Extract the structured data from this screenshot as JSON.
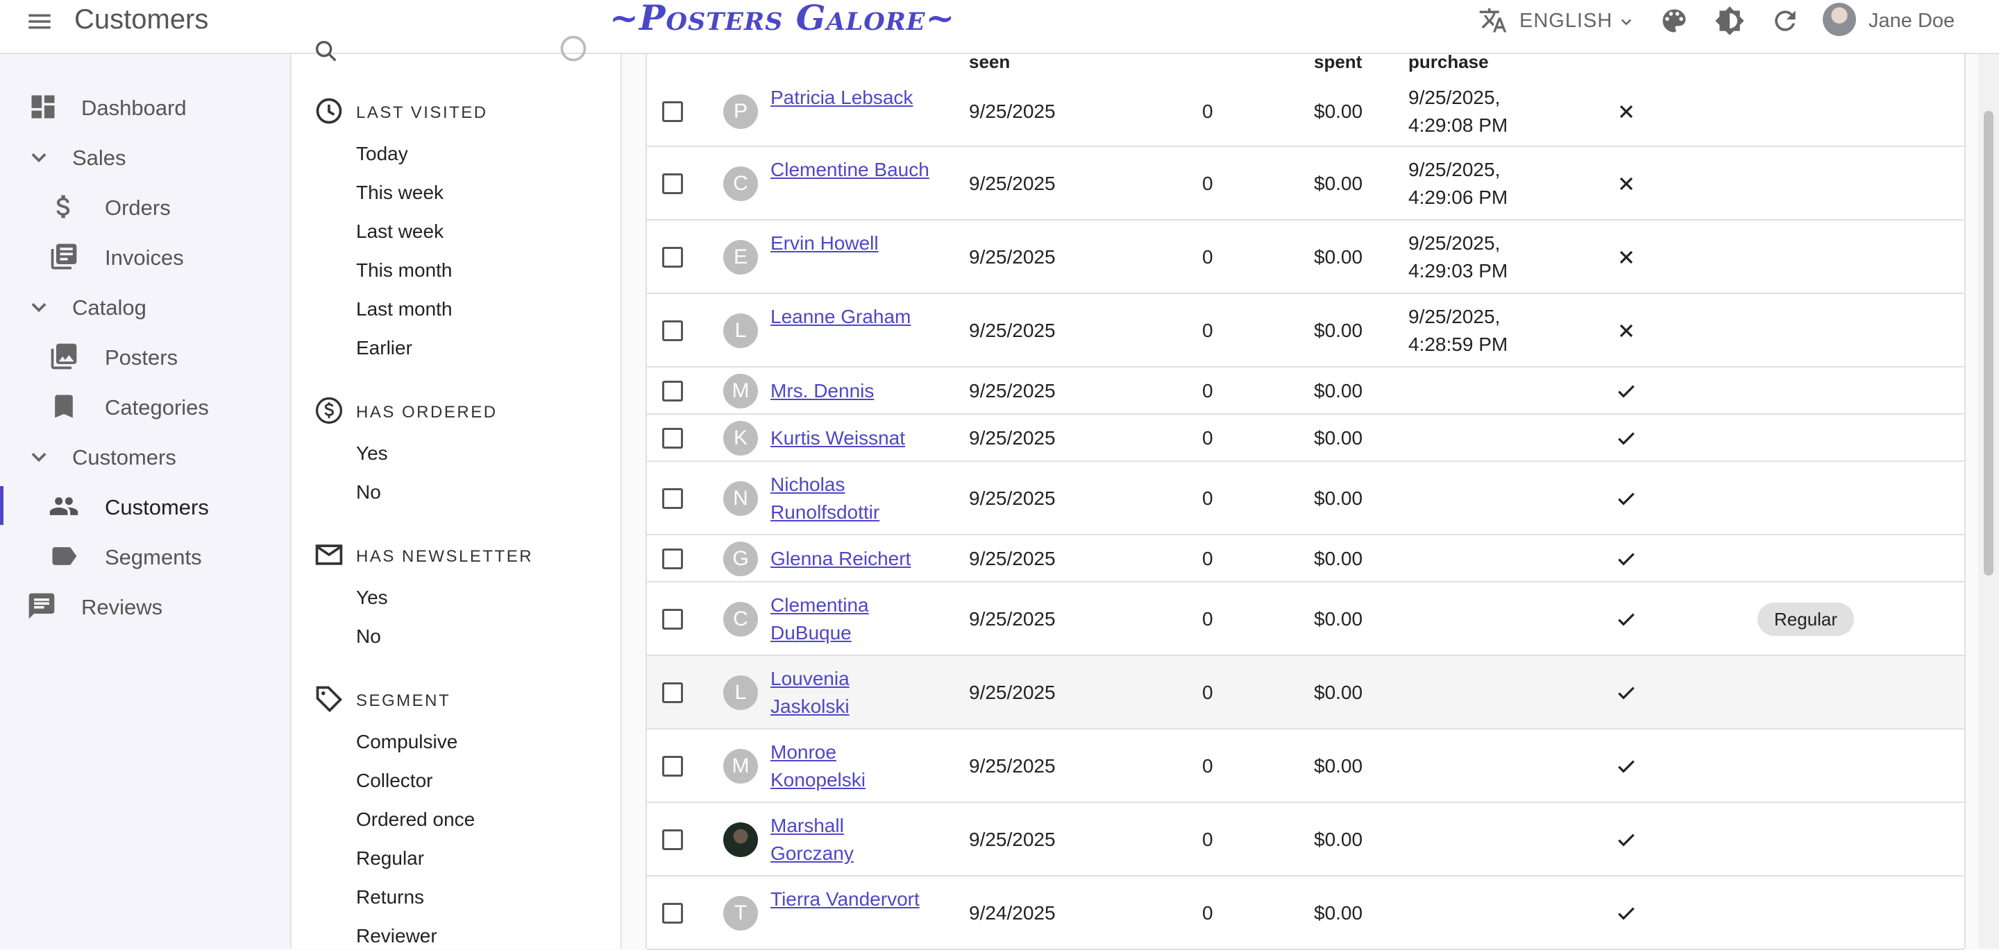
{
  "app": {
    "title": "Customers",
    "logo": "~Posters Galore~",
    "language": "ENGLISH",
    "user": "Jane Doe"
  },
  "sidebar": {
    "items": [
      {
        "label": "Dashboard",
        "icon": "dashboard-icon"
      },
      {
        "label": "Sales",
        "icon": "chevron-down-icon"
      },
      {
        "label": "Orders",
        "icon": "dollar-icon"
      },
      {
        "label": "Invoices",
        "icon": "invoice-icon"
      },
      {
        "label": "Catalog",
        "icon": "chevron-down-icon"
      },
      {
        "label": "Posters",
        "icon": "image-icon"
      },
      {
        "label": "Categories",
        "icon": "bookmark-icon"
      },
      {
        "label": "Customers",
        "icon": "chevron-down-icon"
      },
      {
        "label": "Customers",
        "icon": "people-icon"
      },
      {
        "label": "Segments",
        "icon": "label-icon"
      },
      {
        "label": "Reviews",
        "icon": "comment-icon"
      }
    ]
  },
  "filters": {
    "last_visited": {
      "title": "LAST VISITED",
      "items": [
        "Today",
        "This week",
        "Last week",
        "This month",
        "Last month",
        "Earlier"
      ]
    },
    "has_ordered": {
      "title": "HAS ORDERED",
      "items": [
        "Yes",
        "No"
      ]
    },
    "has_newsletter": {
      "title": "HAS NEWSLETTER",
      "items": [
        "Yes",
        "No"
      ]
    },
    "segment": {
      "title": "SEGMENT",
      "items": [
        "Compulsive",
        "Collector",
        "Ordered once",
        "Regular",
        "Returns",
        "Reviewer"
      ]
    }
  },
  "table": {
    "headers": {
      "last_seen": "seen",
      "total_spent": "spent",
      "latest_purchase": "purchase"
    },
    "rows": [
      {
        "initial": "P",
        "name": "Patricia Lebsack",
        "last_seen": "9/25/2025",
        "orders": "0",
        "spent": "$0.00",
        "latest_purchase": "9/25/2025, 4:29:08 PM",
        "newsletter": false,
        "segment": ""
      },
      {
        "initial": "C",
        "name": "Clementine Bauch",
        "last_seen": "9/25/2025",
        "orders": "0",
        "spent": "$0.00",
        "latest_purchase": "9/25/2025, 4:29:06 PM",
        "newsletter": false,
        "segment": ""
      },
      {
        "initial": "E",
        "name": "Ervin Howell",
        "last_seen": "9/25/2025",
        "orders": "0",
        "spent": "$0.00",
        "latest_purchase": "9/25/2025, 4:29:03 PM",
        "newsletter": false,
        "segment": ""
      },
      {
        "initial": "L",
        "name": "Leanne Graham",
        "last_seen": "9/25/2025",
        "orders": "0",
        "spent": "$0.00",
        "latest_purchase": "9/25/2025, 4:28:59 PM",
        "newsletter": false,
        "segment": ""
      },
      {
        "initial": "M",
        "name": "Mrs. Dennis",
        "last_seen": "9/25/2025",
        "orders": "0",
        "spent": "$0.00",
        "latest_purchase": "",
        "newsletter": true,
        "segment": ""
      },
      {
        "initial": "K",
        "name": "Kurtis Weissnat",
        "last_seen": "9/25/2025",
        "orders": "0",
        "spent": "$0.00",
        "latest_purchase": "",
        "newsletter": true,
        "segment": ""
      },
      {
        "initial": "N",
        "name": "Nicholas Runolfsdottir",
        "last_seen": "9/25/2025",
        "orders": "0",
        "spent": "$0.00",
        "latest_purchase": "",
        "newsletter": true,
        "segment": ""
      },
      {
        "initial": "G",
        "name": "Glenna Reichert",
        "last_seen": "9/25/2025",
        "orders": "0",
        "spent": "$0.00",
        "latest_purchase": "",
        "newsletter": true,
        "segment": ""
      },
      {
        "initial": "C",
        "name": "Clementina DuBuque",
        "last_seen": "9/25/2025",
        "orders": "0",
        "spent": "$0.00",
        "latest_purchase": "",
        "newsletter": true,
        "segment": "Regular"
      },
      {
        "initial": "L",
        "name": "Louvenia Jaskolski",
        "last_seen": "9/25/2025",
        "orders": "0",
        "spent": "$0.00",
        "latest_purchase": "",
        "newsletter": true,
        "segment": ""
      },
      {
        "initial": "M",
        "name": "Monroe Konopelski",
        "last_seen": "9/25/2025",
        "orders": "0",
        "spent": "$0.00",
        "latest_purchase": "",
        "newsletter": true,
        "segment": ""
      },
      {
        "initial": "",
        "name": "Marshall Gorczany",
        "last_seen": "9/25/2025",
        "orders": "0",
        "spent": "$0.00",
        "latest_purchase": "",
        "newsletter": true,
        "segment": ""
      },
      {
        "initial": "T",
        "name": "Tierra Vandervort",
        "last_seen": "9/24/2025",
        "orders": "0",
        "spent": "$0.00",
        "latest_purchase": "",
        "newsletter": true,
        "segment": ""
      }
    ]
  },
  "colors": {
    "accent": "#4f46c8",
    "link": "#4f46c8"
  }
}
